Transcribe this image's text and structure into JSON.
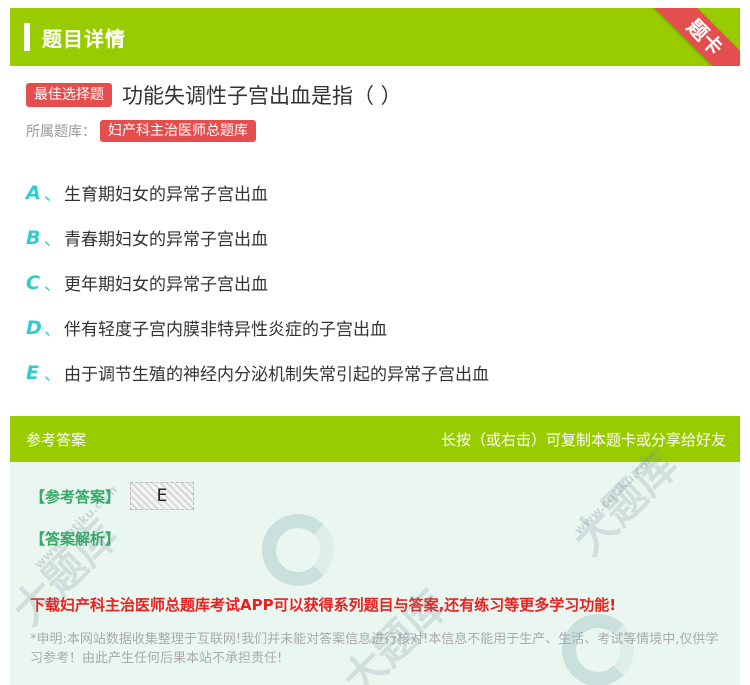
{
  "header": {
    "title": "题目详情",
    "ribbon": "题卡"
  },
  "question": {
    "type_badge": "最佳选择题",
    "text": "功能失调性子宫出血是指（ ）",
    "library_label": "所属题库：",
    "library_name": "妇产科主治医师总题库"
  },
  "options": [
    {
      "letter": "A",
      "sep": "、",
      "text": "生育期妇女的异常子宫出血"
    },
    {
      "letter": "B",
      "sep": "、",
      "text": "青春期妇女的异常子宫出血"
    },
    {
      "letter": "C",
      "sep": "、",
      "text": "更年期妇女的异常子宫出血"
    },
    {
      "letter": "D",
      "sep": "、",
      "text": "伴有轻度子宫内膜非特异性炎症的子宫出血"
    },
    {
      "letter": "E",
      "sep": "、",
      "text": "由于调节生殖的神经内分泌机制失常引起的异常子宫出血"
    }
  ],
  "answer": {
    "section_title": "参考答案",
    "hint": "长按（或右击）可复制本题卡或分享给好友",
    "answer_label": "【参考答案】",
    "answer_value": "E",
    "analysis_label": "【答案解析】",
    "promo": "下载妇产科主治医师总题库考试APP可以获得系列题目与答案,还有练习等更多学习功能!",
    "notice": "*申明:本网站数据收集整理于互联网!我们并未能对答案信息进行核对!本信息不能用于生产、生活、考试等情境中,仅供学习参考！由此产生任何后果本站不承担责任!"
  },
  "watermark": {
    "brand": "大题库",
    "domain": "www.cqtiku.com"
  },
  "colors": {
    "green": "#99cc00",
    "red": "#e54e4e",
    "teal": "#33cccc",
    "panel": "#eaf7f1"
  }
}
